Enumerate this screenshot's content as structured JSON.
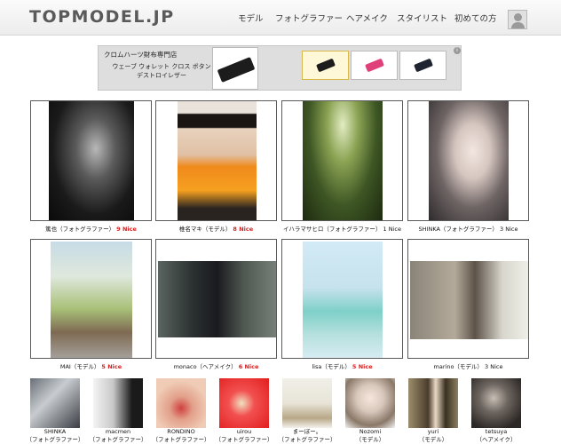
{
  "header": {
    "logo": "TOPMODEL.JP",
    "nav": [
      "モデル",
      "フォトグラファー",
      "ヘアメイク",
      "スタイリスト",
      "初めての方"
    ]
  },
  "ad": {
    "title": "クロムハーツ財布専門店",
    "subtitle": "ウェーブ ウォレット クロス ボタン デストロイレザー",
    "info": "i",
    "wallet_colors": [
      "#1c1c1c",
      "#1c1c1c",
      "#e0407a",
      "#1e2430"
    ]
  },
  "featured": [
    {
      "name": "篤也（フォトグラファー）",
      "nice": "9 Nice",
      "highlight": true
    },
    {
      "name": "椎名マキ（モデル）",
      "nice": "8 Nice",
      "highlight": true
    },
    {
      "name": "イハラマサヒロ（フォトグラファー）",
      "nice": "1 Nice",
      "highlight": false
    },
    {
      "name": "SHINKA（フォトグラファー）",
      "nice": "3 Nice",
      "highlight": false
    },
    {
      "name": "MAI（モデル）",
      "nice": "5 Nice",
      "highlight": true
    },
    {
      "name": "monaco（ヘアメイク）",
      "nice": "6 Nice",
      "highlight": true
    },
    {
      "name": "lisa（モデル）",
      "nice": "5 Nice",
      "highlight": true
    },
    {
      "name": "marino（モデル）",
      "nice": "3 Nice",
      "highlight": false
    }
  ],
  "thumbs": [
    {
      "name": "SHINKA",
      "role": "（フォトグラファー）"
    },
    {
      "name": "macmen",
      "role": "（フォトグラファー）"
    },
    {
      "name": "RONDINO",
      "role": "（フォトグラファー）"
    },
    {
      "name": "uirou",
      "role": "（フォトグラファー）"
    },
    {
      "name": "まーぼー。",
      "role": "（フォトグラファー）"
    },
    {
      "name": "Nozomi",
      "role": "（モデル）"
    },
    {
      "name": "yuri",
      "role": "（モデル）"
    },
    {
      "name": "tetsuya",
      "role": "（ヘアメイク）"
    }
  ]
}
